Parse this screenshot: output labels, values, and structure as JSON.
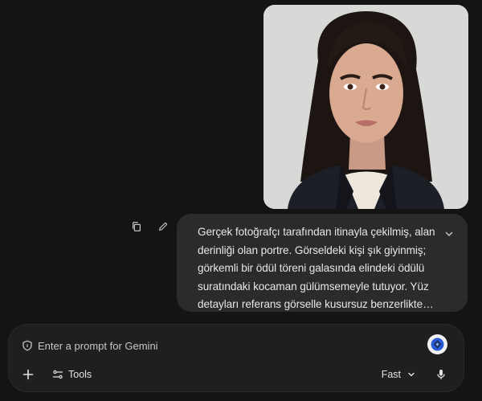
{
  "message": {
    "text": "Gerçek fotoğrafçı tarafından itinayla çekilmiş, alan derinliği olan portre. Görseldeki kişi şık giyinmiş; görkemli bir ödül töreni galasında elindeki ödülü suratındaki kocaman gülümsemeyle tutuyor. Yüz detayları referans görselle kusursuz benzerlikte. Ödül oldukça büyük, bir…",
    "actions": [
      "copy-icon",
      "edit-icon"
    ],
    "expand_icon": "chevron-down-icon"
  },
  "attachment": {
    "kind": "portrait photo",
    "background": "#d7d7d6"
  },
  "composer": {
    "placeholder": "Enter a prompt for Gemini",
    "tools_label": "Tools",
    "mode_label": "Fast"
  },
  "colors": {
    "page_bg": "#141414",
    "bubble_bg": "#2b2b2d",
    "composer_bg": "#1f1f1f",
    "text": "#e3e3e3"
  }
}
